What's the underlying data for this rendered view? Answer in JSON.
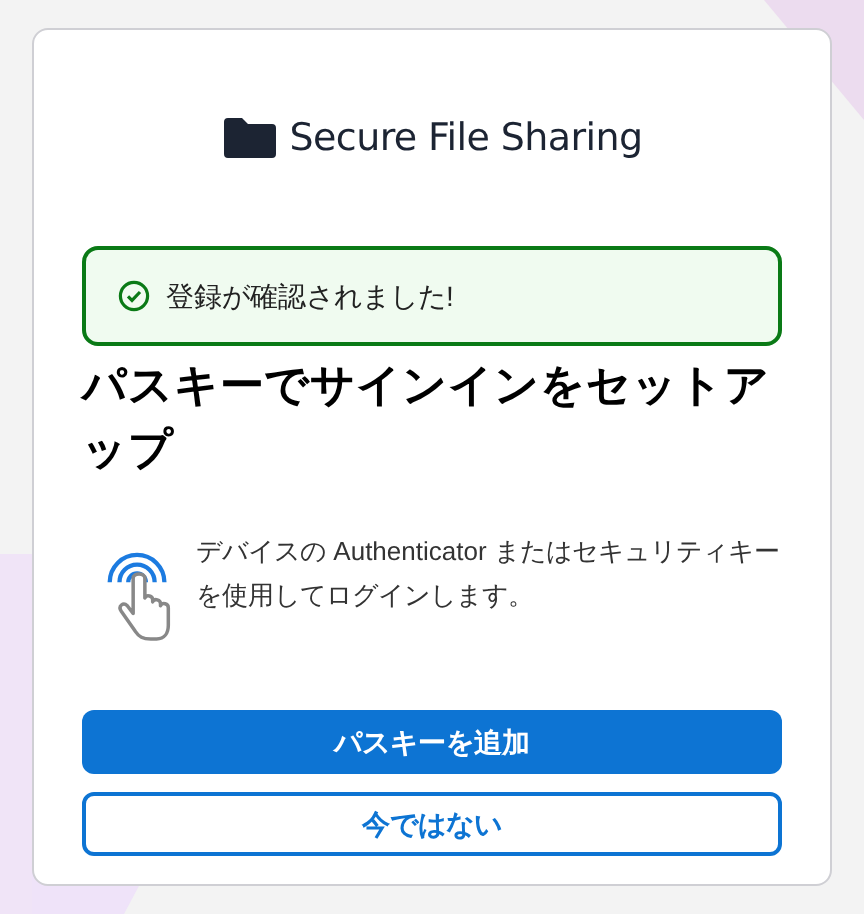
{
  "logo": {
    "text": "Secure File Sharing"
  },
  "alert": {
    "kind": "success",
    "message": "登録が確認されました!"
  },
  "heading": "パスキーでサインインをセットアップ",
  "description": "デバイスの Authenticator またはセキュリティキーを使用してログインします。",
  "buttons": [
    {
      "label": "パスキーを追加",
      "kind": "primary"
    },
    {
      "label": "今ではない",
      "kind": "secondary"
    }
  ]
}
